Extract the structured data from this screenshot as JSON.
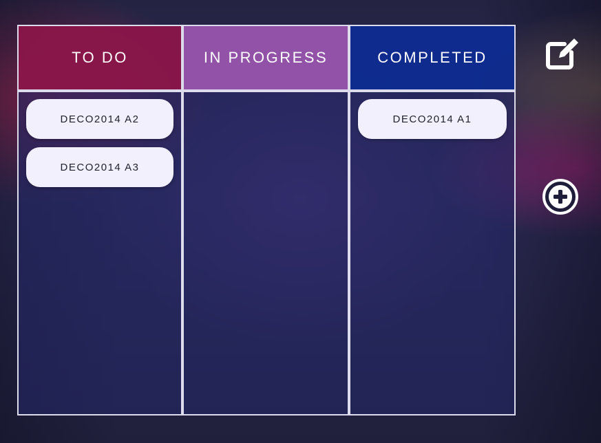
{
  "board": {
    "columns": [
      {
        "title": "TO DO",
        "cards": [
          "DECO2014 A2",
          "DECO2014 A3"
        ]
      },
      {
        "title": "IN PROGRESS",
        "cards": []
      },
      {
        "title": "COMPLETED",
        "cards": [
          "DECO2014 A1"
        ]
      }
    ]
  },
  "toolbar": {
    "edit_icon": "edit-square-icon",
    "add_icon": "plus-circle-icon"
  },
  "colors": {
    "todo_header": "#96144b",
    "progress_header": "#af5fbe",
    "completed_header": "#0a2d96",
    "card_bg": "#f1f0fc",
    "border": "#dcdcec"
  }
}
